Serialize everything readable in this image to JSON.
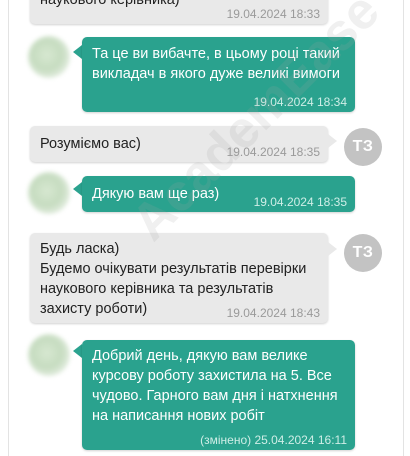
{
  "watermark": "AcademEase",
  "messages": [
    {
      "text": "наукового керівника)",
      "time": "19.04.2024 18:33"
    },
    {
      "text": "Та це ви вибачте, в цьому році такий викладач в якого дуже великі вимоги",
      "time": "19.04.2024 18:34"
    },
    {
      "text": "Розуміємо вас)",
      "time": "19.04.2024 18:35",
      "avatar": "ТЗ"
    },
    {
      "text": "Дякую вам ще раз)",
      "time": "19.04.2024 18:35"
    },
    {
      "text": "Будь ласка)\nБудемо очікувати результатів перевірки наукового керівника та результатів захисту роботи)",
      "time": "19.04.2024 18:43",
      "avatar": "ТЗ"
    },
    {
      "text": "Добрий день, дякую вам велике курсову роботу захистила на 5. Все чудово. Гарного вам дня і натхнення на написання нових робіт",
      "time": "(змінено) 25.04.2024 16:11"
    }
  ]
}
